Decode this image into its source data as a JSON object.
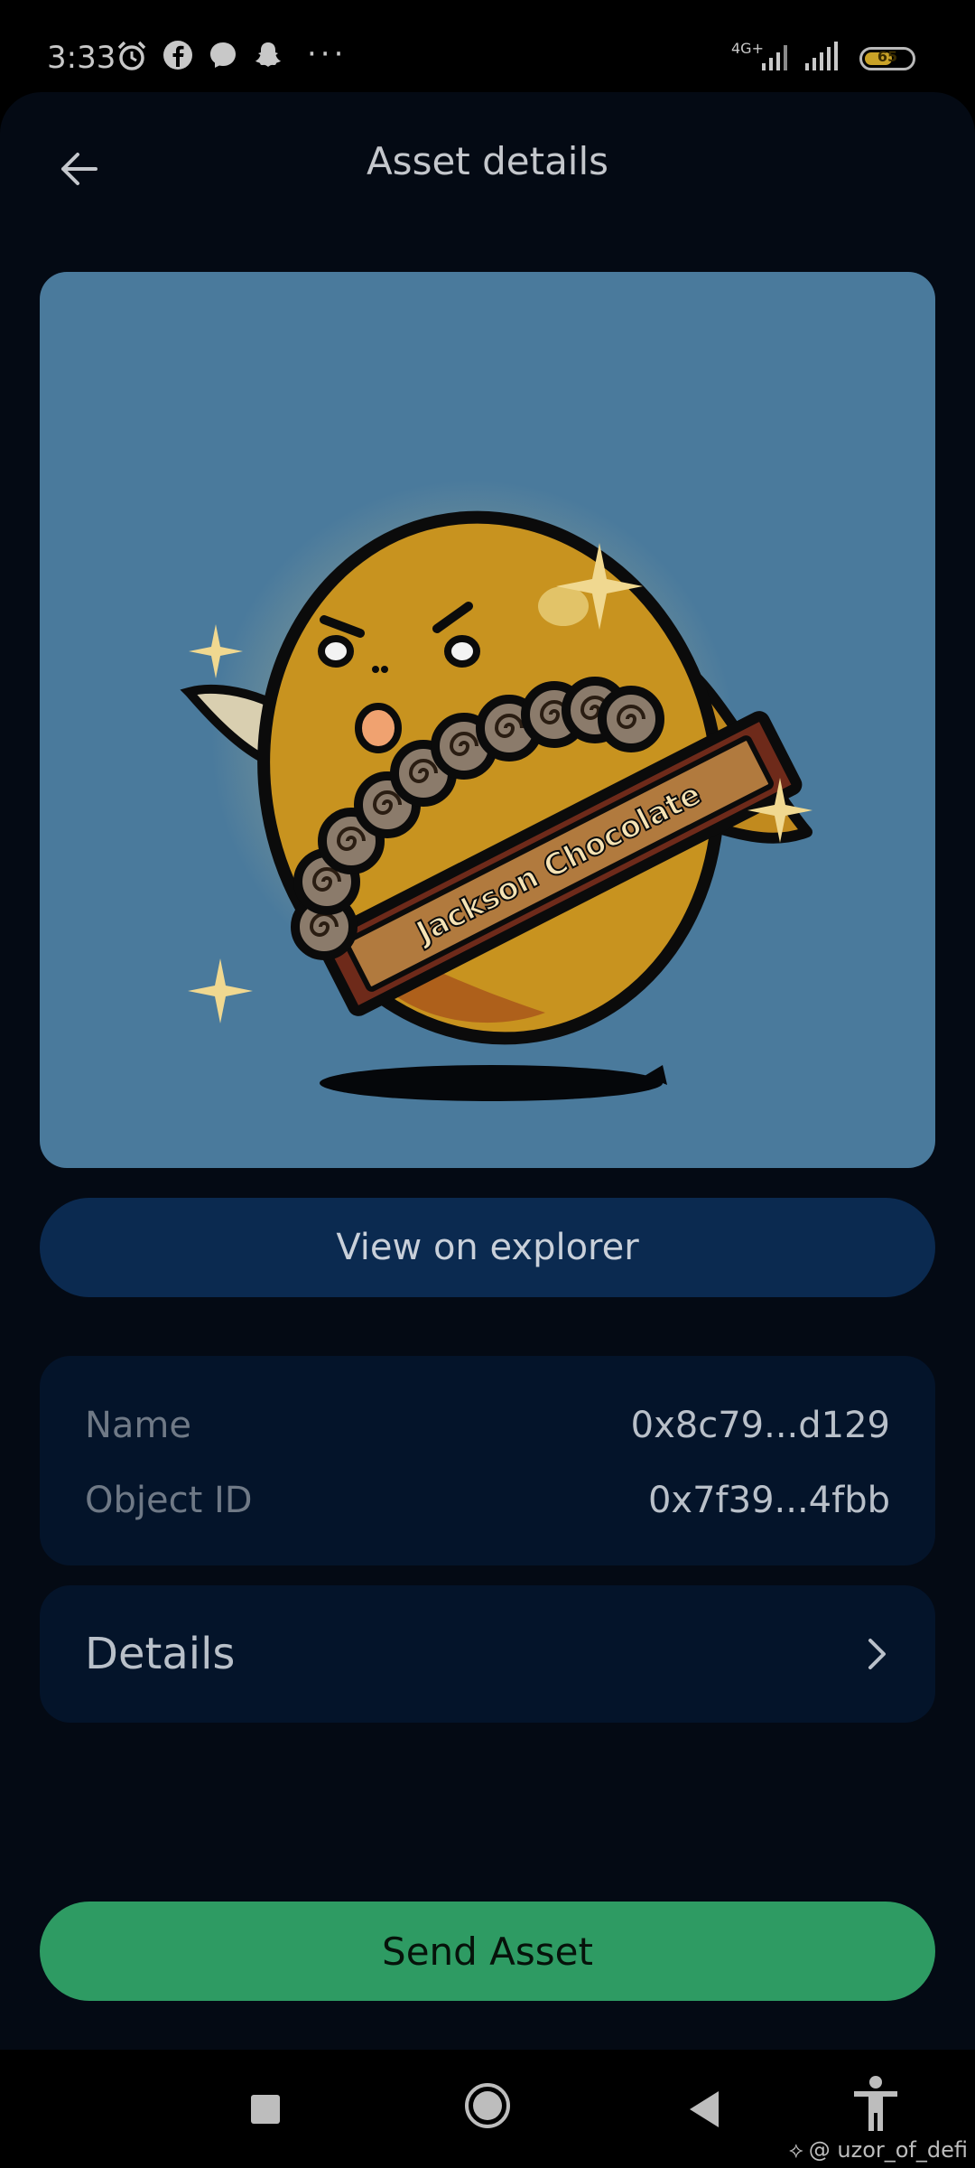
{
  "status_bar": {
    "time": "3:33",
    "network_label": "4G+",
    "battery_level": "65",
    "battery_percent": 65,
    "notification_icons": [
      "alarm-icon",
      "facebook-icon",
      "messenger-icon",
      "snapchat-icon",
      "more-dots-icon"
    ]
  },
  "header": {
    "title": "Asset details",
    "back_icon": "arrow-left-icon"
  },
  "asset": {
    "image_subject": "nft-fish-mascot",
    "banner_text": "Jackson Chocolate"
  },
  "explorer_button": {
    "label": "View on explorer"
  },
  "info": {
    "rows": [
      {
        "label": "Name",
        "value": "0x8c79...d129"
      },
      {
        "label": "Object ID",
        "value": "0x7f39...4fbb"
      }
    ]
  },
  "details": {
    "label": "Details",
    "chevron_icon": "chevron-right-icon"
  },
  "send_button": {
    "label": "Send Asset"
  },
  "nav_bar": {
    "icons": [
      "recents-square-icon",
      "home-circle-icon",
      "back-triangle-icon",
      "accessibility-icon"
    ],
    "watermark": "@ uzor_of_defi"
  },
  "colors": {
    "background": "#040a14",
    "card": "#04142a",
    "explorer_button": "#0b2a50",
    "send_button": "#2e9b63",
    "image_bg": "#4a7a9c"
  }
}
